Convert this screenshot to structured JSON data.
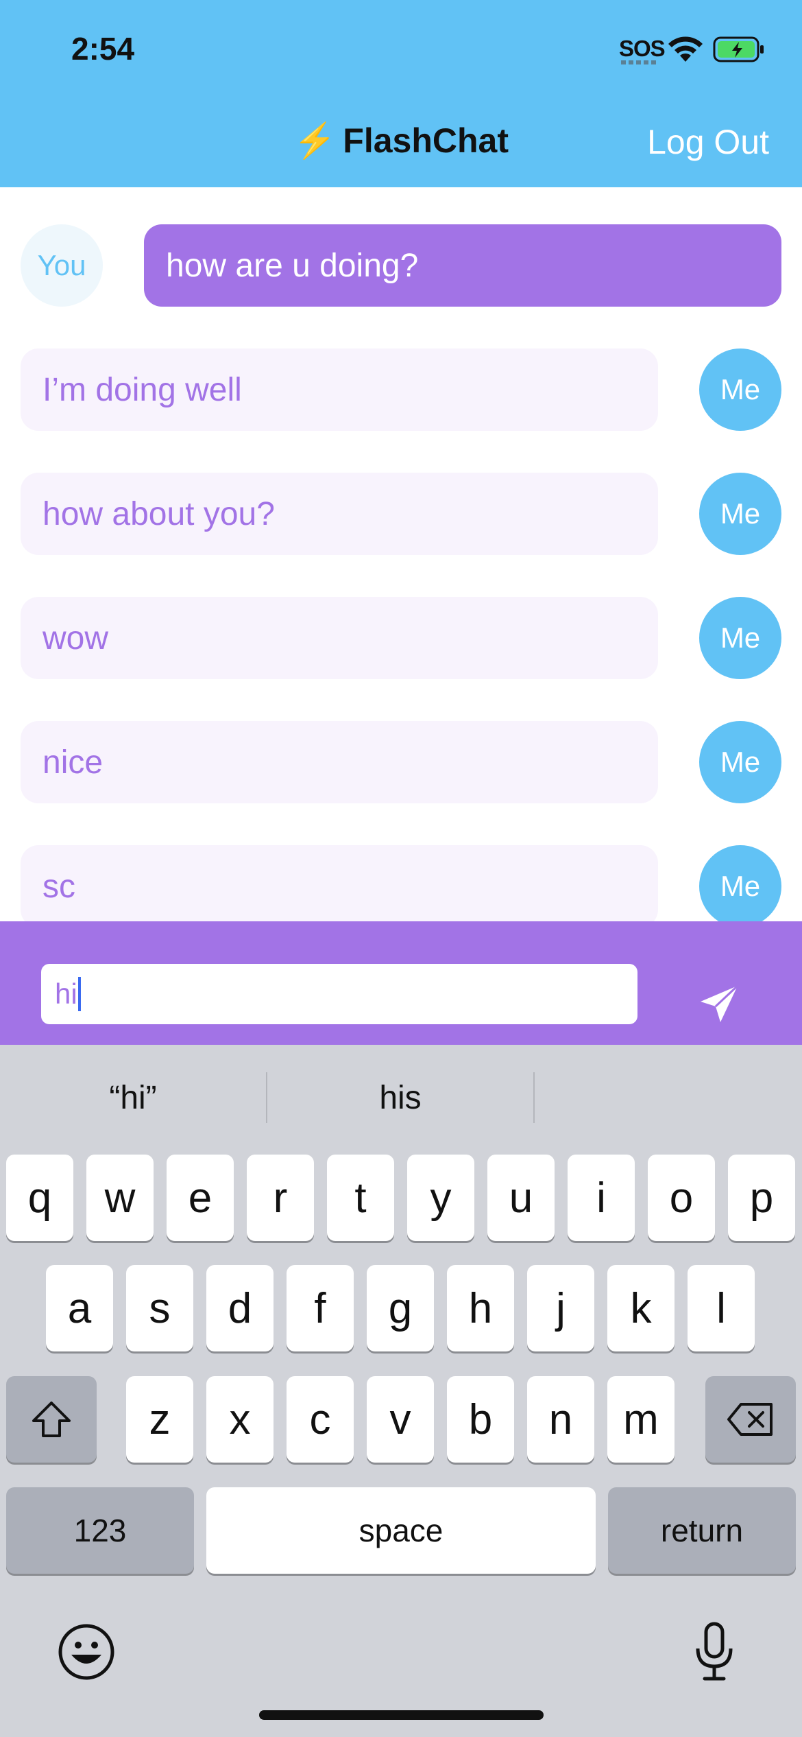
{
  "status_bar": {
    "time": "2:54",
    "sos": "SOS"
  },
  "nav": {
    "bolt": "⚡",
    "title": "FlashChat",
    "logout_label": "Log Out"
  },
  "messages": [
    {
      "sender": "You",
      "text": "how are u doing?"
    },
    {
      "sender": "Me",
      "text": "I’m doing well"
    },
    {
      "sender": "Me",
      "text": "how about you?"
    },
    {
      "sender": "Me",
      "text": "wow"
    },
    {
      "sender": "Me",
      "text": "nice"
    },
    {
      "sender": "Me",
      "text": "sc"
    }
  ],
  "composer": {
    "value": "hi",
    "send_icon": "paper-plane-icon"
  },
  "keyboard": {
    "suggestions": [
      "“hi”",
      "his",
      ""
    ],
    "row1": [
      "q",
      "w",
      "e",
      "r",
      "t",
      "y",
      "u",
      "i",
      "o",
      "p"
    ],
    "row2": [
      "a",
      "s",
      "d",
      "f",
      "g",
      "h",
      "j",
      "k",
      "l"
    ],
    "row3": [
      "z",
      "x",
      "c",
      "v",
      "b",
      "n",
      "m"
    ],
    "numbers_label": "123",
    "space_label": "space",
    "return_label": "return",
    "icons": {
      "shift": "shift-icon",
      "delete": "delete-icon",
      "emoji": "emoji-icon",
      "mic": "microphone-icon"
    }
  },
  "colors": {
    "header": "#61C2F5",
    "accent": "#A273E6",
    "bubble_light": "#F8F3FD",
    "keyboard_bg": "#D1D3D9"
  }
}
